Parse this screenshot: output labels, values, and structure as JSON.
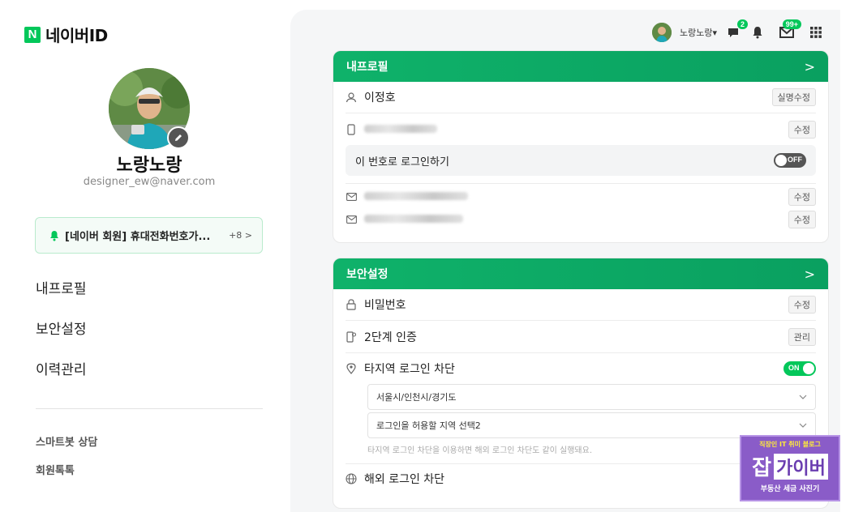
{
  "logo": {
    "letter": "N",
    "text": "네이버ID"
  },
  "profile": {
    "nickname": "노랑노랑",
    "email": "designer_ew@naver.com"
  },
  "notice": {
    "text": "[네이버 회원] 휴대전화번호가...",
    "count": "+8 >"
  },
  "menu": [
    "내프로필",
    "보안설정",
    "이력관리"
  ],
  "sub_menu": [
    "스마트봇 상담",
    "회원톡톡"
  ],
  "topbar": {
    "name": "노랑노랑▾",
    "chat_badge": "2",
    "mail_badge": "99+"
  },
  "profile_card": {
    "title": "내프로필",
    "arrow": ">",
    "name": "이정호",
    "name_btn": "실명수정",
    "phone_btn": "수정",
    "login_with_phone": "이 번호로 로그인하기",
    "toggle_off": "OFF",
    "email1_btn": "수정",
    "email2_btn": "수정"
  },
  "security_card": {
    "title": "보안설정",
    "arrow": ">",
    "password": "비밀번호",
    "password_btn": "수정",
    "two_step": "2단계 인증",
    "two_step_btn": "관리",
    "region_block": "타지역 로그인 차단",
    "toggle_on": "ON",
    "select1": "서울시/인천시/경기도",
    "select2": "로그인을 허용할 지역 선택2",
    "hint": "타지역 로그인 차단을 이용하면 해외 로그인 차단도 같이 실행돼요.",
    "overseas_block": "해외 로그인 차단"
  },
  "watermark": {
    "top": "직장인 IT 취미 블로그",
    "left": "잡",
    "right": "가이버",
    "bottom": "부동산 세금 사진기"
  }
}
